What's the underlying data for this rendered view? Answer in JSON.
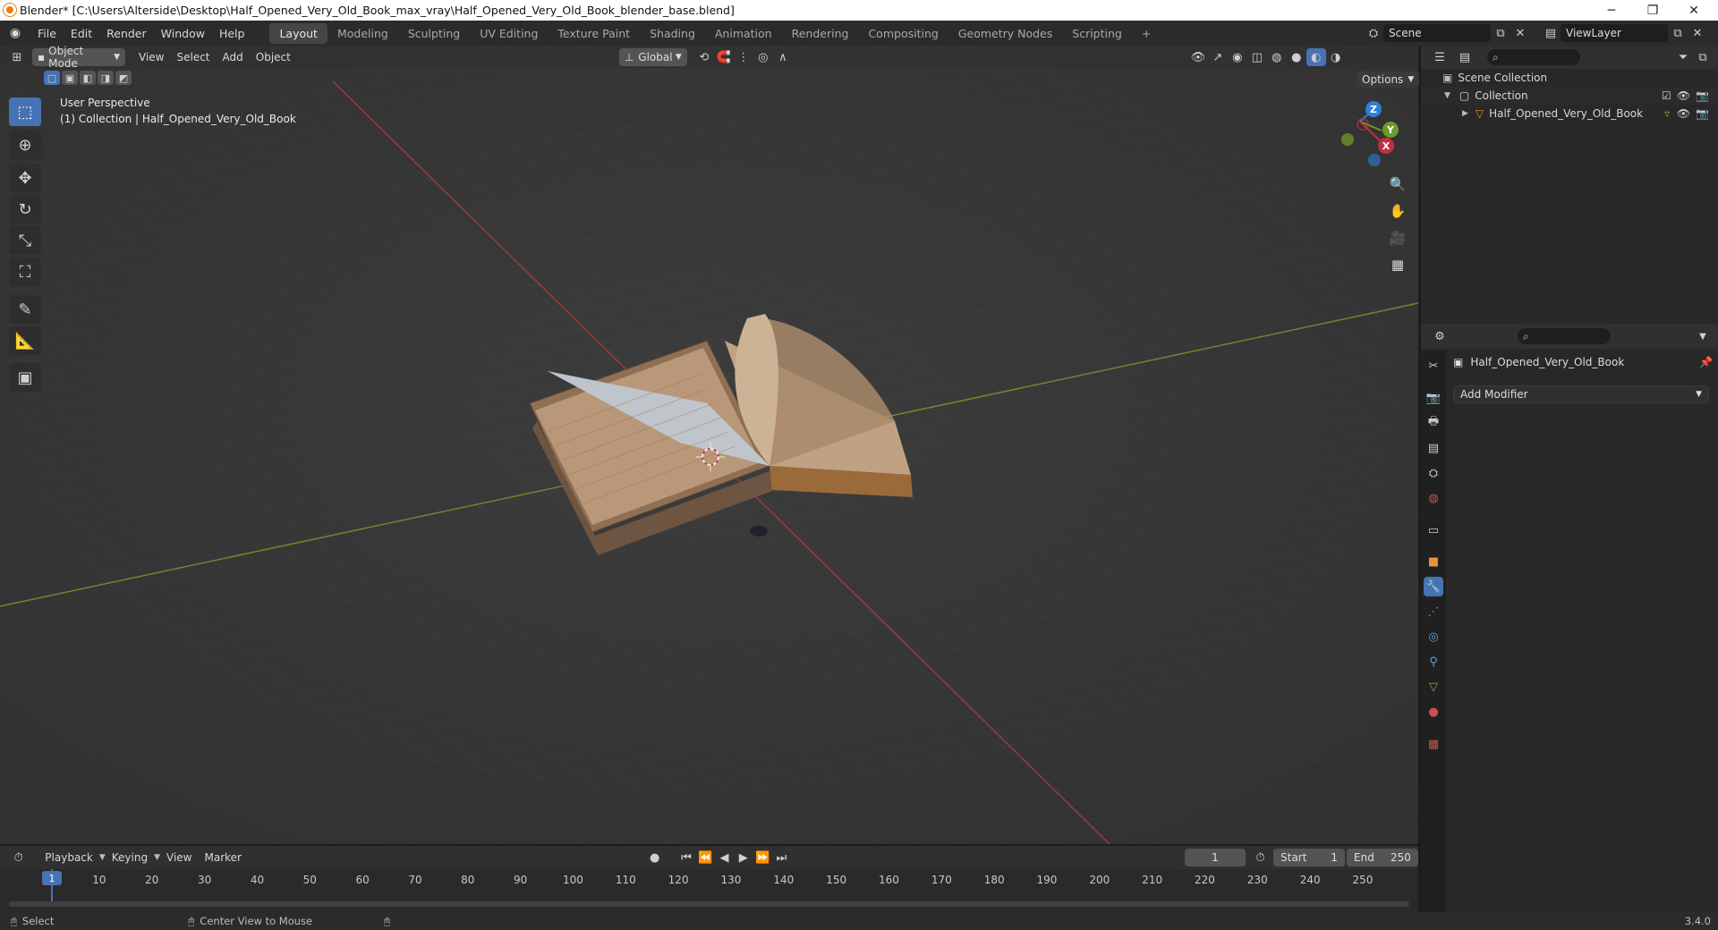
{
  "window": {
    "title": "Blender* [C:\\Users\\Alterside\\Desktop\\Half_Opened_Very_Old_Book_max_vray\\Half_Opened_Very_Old_Book_blender_base.blend]",
    "minimize": "─",
    "restore": "❐",
    "close": "✕"
  },
  "menu": {
    "items": [
      "File",
      "Edit",
      "Render",
      "Window",
      "Help"
    ],
    "workspaces": [
      "Layout",
      "Modeling",
      "Sculpting",
      "UV Editing",
      "Texture Paint",
      "Shading",
      "Animation",
      "Rendering",
      "Compositing",
      "Geometry Nodes",
      "Scripting"
    ],
    "add_workspace": "+",
    "scene": "Scene",
    "view_layer": "ViewLayer"
  },
  "viewport": {
    "mode": "Object Mode",
    "menus": [
      "View",
      "Select",
      "Add",
      "Object"
    ],
    "orientation": "Global",
    "options": "Options",
    "perspective": "User Perspective",
    "collection_info": "(1) Collection | Half_Opened_Very_Old_Book",
    "gizmo": {
      "z": "Z",
      "y": "Y",
      "x": "X"
    }
  },
  "outliner": {
    "scene_collection": "Scene Collection",
    "collection": "Collection",
    "object": "Half_Opened_Very_Old_Book"
  },
  "properties": {
    "object_name": "Half_Opened_Very_Old_Book",
    "add_modifier": "Add Modifier"
  },
  "timeline": {
    "menus": [
      "Playback",
      "Keying",
      "View",
      "Marker"
    ],
    "current_frame": "1",
    "start_label": "Start",
    "start": "1",
    "end_label": "End",
    "end": "250",
    "ticks": [
      "1",
      "10",
      "20",
      "30",
      "40",
      "50",
      "60",
      "70",
      "80",
      "90",
      "100",
      "110",
      "120",
      "130",
      "140",
      "150",
      "160",
      "170",
      "180",
      "190",
      "200",
      "210",
      "220",
      "230",
      "240",
      "250"
    ]
  },
  "status": {
    "select": "Select",
    "center_view": "Center View to Mouse",
    "version": "3.4.0"
  },
  "colors": {
    "accent": "#4772b3",
    "x_axis": "#c1303f",
    "y_axis": "#6f9a2b",
    "z_axis": "#2e7fd9"
  }
}
